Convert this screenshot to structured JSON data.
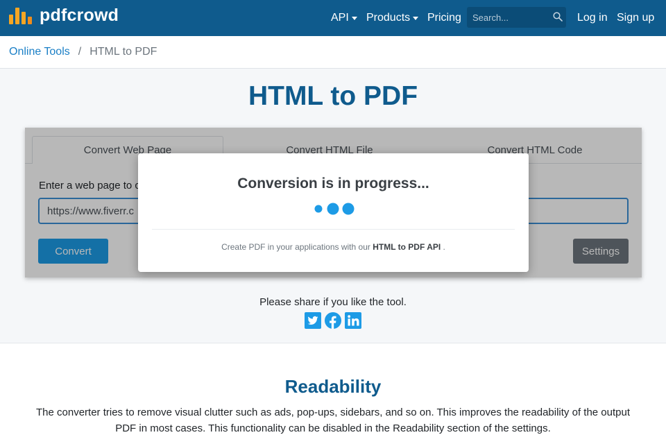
{
  "brand": {
    "name": "pdfcrowd",
    "logo_colors": [
      "#f5a623",
      "#f08c1b"
    ]
  },
  "nav": {
    "api_label": "API",
    "products_label": "Products",
    "pricing_label": "Pricing",
    "search_placeholder": "Search...",
    "login_label": "Log in",
    "signup_label": "Sign up"
  },
  "breadcrumb": {
    "root": "Online Tools",
    "separator": "/",
    "current": "HTML to PDF"
  },
  "page": {
    "title": "HTML to PDF"
  },
  "tool": {
    "tabs": [
      {
        "label": "Convert Web Page",
        "active": true
      },
      {
        "label": "Convert HTML File",
        "active": false
      },
      {
        "label": "Convert HTML Code",
        "active": false
      }
    ],
    "url_label": "Enter a web page to c",
    "url_value": "https://www.fiverr.c",
    "convert_label": "Convert",
    "settings_label": "Settings"
  },
  "modal": {
    "title": "Conversion is in progress...",
    "footer_prefix": "Create PDF in your applications with our",
    "footer_link": "HTML to PDF API",
    "footer_suffix": "."
  },
  "share": {
    "text": "Please share if you like the tool.",
    "icons": [
      "twitter-icon",
      "facebook-icon",
      "linkedin-icon"
    ]
  },
  "readability": {
    "title": "Readability",
    "text": "The converter tries to remove visual clutter such as ads, pop-ups, sidebars, and so on. This improves the readability of the output PDF in most cases. This functionality can be disabled in the Readability section of the settings."
  },
  "colors": {
    "nav_bg": "#0f5b8d",
    "accent": "#1d9be6",
    "link": "#1a7fc6",
    "secondary_btn": "#6c757d",
    "social": "#1d9be6"
  }
}
